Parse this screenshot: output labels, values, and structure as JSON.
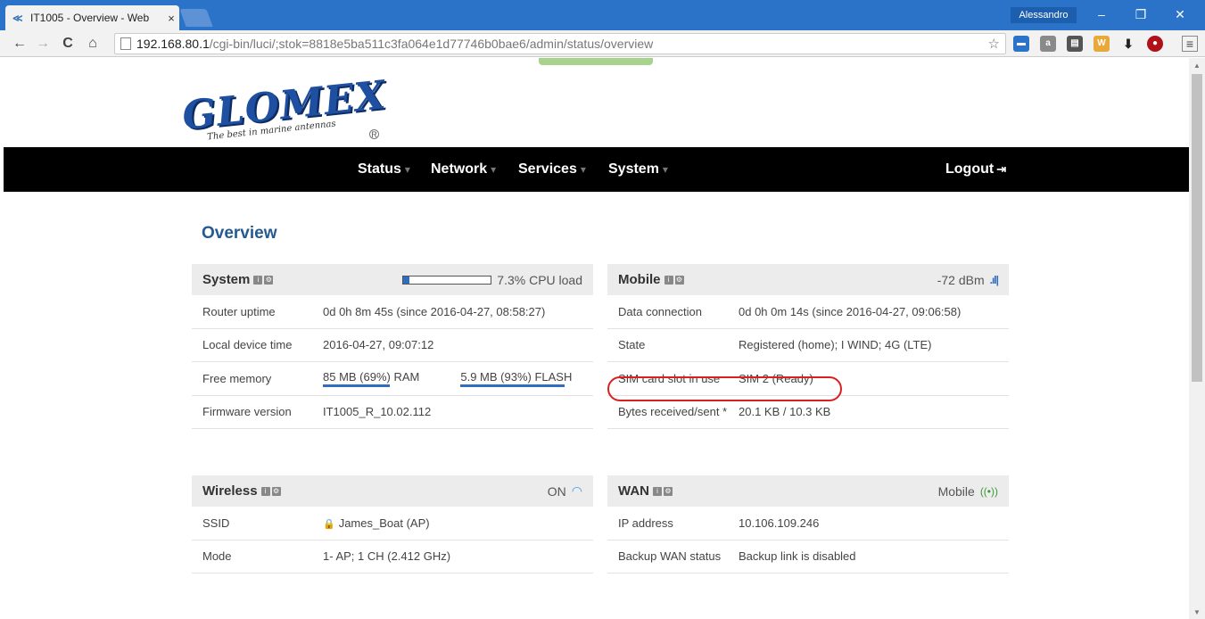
{
  "browser": {
    "tab_title": "IT1005 - Overview - Web",
    "tab_close": "×",
    "profile": "Alessandro",
    "window_buttons": [
      "–",
      "❐",
      "✕"
    ],
    "url_host": "192.168.80.1",
    "url_path": "/cgi-bin/luci/;stok=8818e5ba511c3fa064e1d77746b0bae6/admin/status/overview",
    "icons": [
      "back-icon",
      "forward-icon",
      "reload-icon",
      "home-icon",
      "star-icon",
      "menu-icon"
    ]
  },
  "logo": {
    "text": "GLOMEX",
    "tagline": "The best in marine antennas",
    "reg": "R"
  },
  "menu": {
    "items": [
      "Status",
      "Network",
      "Services",
      "System"
    ],
    "logout": "Logout"
  },
  "page_title": "Overview",
  "system": {
    "title": "System",
    "cpu_label": "7.3% CPU load",
    "cpu_fraction": 0.073,
    "rows": [
      {
        "label": "Router uptime",
        "value": "0d 0h 8m 45s (since 2016-04-27, 08:58:27)"
      },
      {
        "label": "Local device time",
        "value": "2016-04-27, 09:07:12"
      },
      {
        "label": "Free memory",
        "ram": "85 MB (69%) RAM",
        "ram_fraction": 0.69,
        "flash": "5.9 MB (93%) FLASH",
        "flash_fraction": 0.93
      },
      {
        "label": "Firmware version",
        "value": "IT1005_R_10.02.112"
      }
    ]
  },
  "mobile": {
    "title": "Mobile",
    "signal": "-72 dBm",
    "rows": [
      {
        "label": "Data connection",
        "value": "0d 0h 0m 14s (since 2016-04-27, 09:06:58)"
      },
      {
        "label": "State",
        "value": "Registered (home); I WIND; 4G (LTE)"
      },
      {
        "label": "SIM card slot in use",
        "value": "SIM 2 (Ready)"
      },
      {
        "label": "Bytes received/sent *",
        "value": "20.1 KB / 10.3 KB"
      }
    ]
  },
  "wireless": {
    "title": "Wireless",
    "status": "ON",
    "rows": [
      {
        "label": "SSID",
        "value": "James_Boat (AP)"
      },
      {
        "label": "Mode",
        "value": "1- AP; 1 CH (2.412 GHz)"
      }
    ]
  },
  "wan": {
    "title": "WAN",
    "status": "Mobile",
    "rows": [
      {
        "label": "IP address",
        "value": "10.106.109.246"
      },
      {
        "label": "Backup WAN status",
        "value": "Backup link is disabled"
      }
    ]
  }
}
